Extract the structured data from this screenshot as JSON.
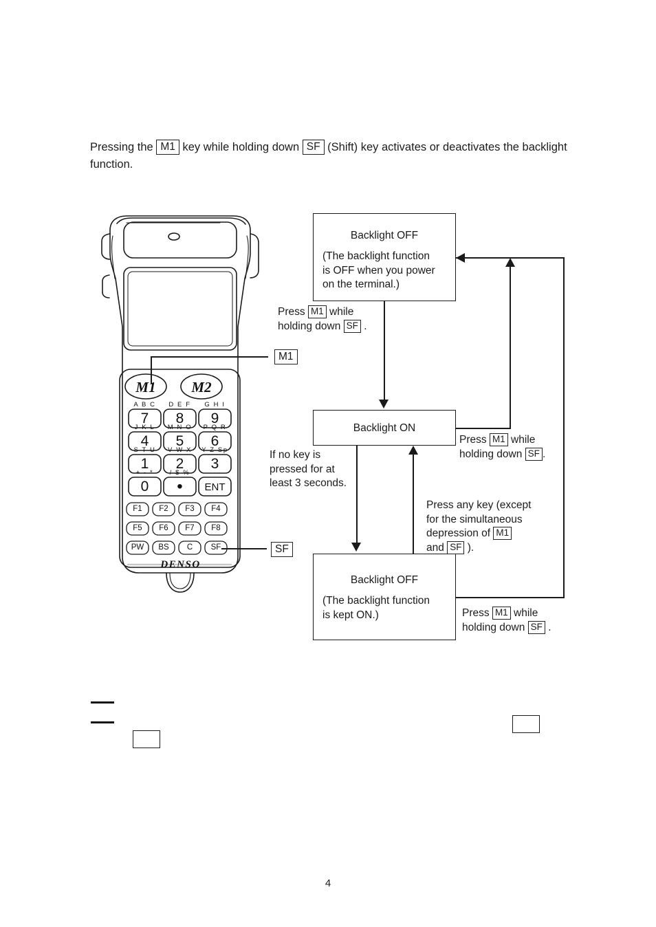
{
  "document": {
    "page_number": "4"
  },
  "intro": {
    "part1": "Pressing the",
    "key_m1": "M1",
    "part2": "key while holding down",
    "key_sf": "SF",
    "part3": "(Shift) key activates or deactivates the backlight function."
  },
  "flow": {
    "box_off_power": {
      "title": "Backlight OFF",
      "line1": "(The backlight function",
      "line2": "is OFF when you power",
      "line3": "on the terminal.)"
    },
    "box_on": {
      "title": "Backlight ON"
    },
    "box_off_kept": {
      "title": "Backlight OFF",
      "line1": "(The backlight function",
      "line2": "is kept ON.)"
    },
    "notes": {
      "press_m1_hold_sf_top": {
        "l1_pre": "Press",
        "l1_key": "M1",
        "l1_post": "while",
        "l2_pre": "holding down",
        "l2_key": "SF",
        "l2_post": "."
      },
      "timeout": {
        "l1": "If no key is",
        "l2": "pressed for at",
        "l3": "least 3 seconds."
      },
      "press_m1_hold_sf_mid": {
        "l1_pre": "Press",
        "l1_key": "M1",
        "l1_post": "while",
        "l2_pre": "holding down",
        "l2_key": "SF",
        "l2_post": "."
      },
      "press_any_key": {
        "l1": "Press any key (except",
        "l2": "for the simultaneous",
        "l3_pre": "depression of",
        "l3_key": "M1",
        "l4_pre": "and",
        "l4_key": "SF",
        "l4_post": ")."
      },
      "press_m1_hold_sf_bottom": {
        "l1_pre": "Press",
        "l1_key": "M1",
        "l1_post": "while",
        "l2_pre": "holding down",
        "l2_key": "SF",
        "l2_post": "."
      }
    }
  },
  "terminal": {
    "callout_m1": "M1",
    "callout_sf": "SF",
    "brand": "DENSO",
    "keys": {
      "memory": [
        "M1",
        "M2"
      ],
      "alpha_labels": [
        [
          "A B C",
          "D E F",
          "G H I"
        ],
        [
          "J K L",
          "M N O",
          "P Q R"
        ],
        [
          "S T U",
          "V W X",
          "Y Z Sp"
        ],
        [
          "+ - *",
          "/ $ %",
          ""
        ]
      ],
      "numeric": [
        [
          "7",
          "8",
          "9"
        ],
        [
          "4",
          "5",
          "6"
        ],
        [
          "1",
          "2",
          "3"
        ],
        [
          "0",
          "•",
          "ENT"
        ]
      ],
      "function_row1": [
        "F1",
        "F2",
        "F3",
        "F4"
      ],
      "function_row2": [
        "F5",
        "F6",
        "F7",
        "F8"
      ],
      "function_row3": [
        "PW",
        "BS",
        "C",
        "SF"
      ]
    }
  },
  "colors": {
    "ink": "#1a1a1a",
    "paper": "#ffffff"
  }
}
